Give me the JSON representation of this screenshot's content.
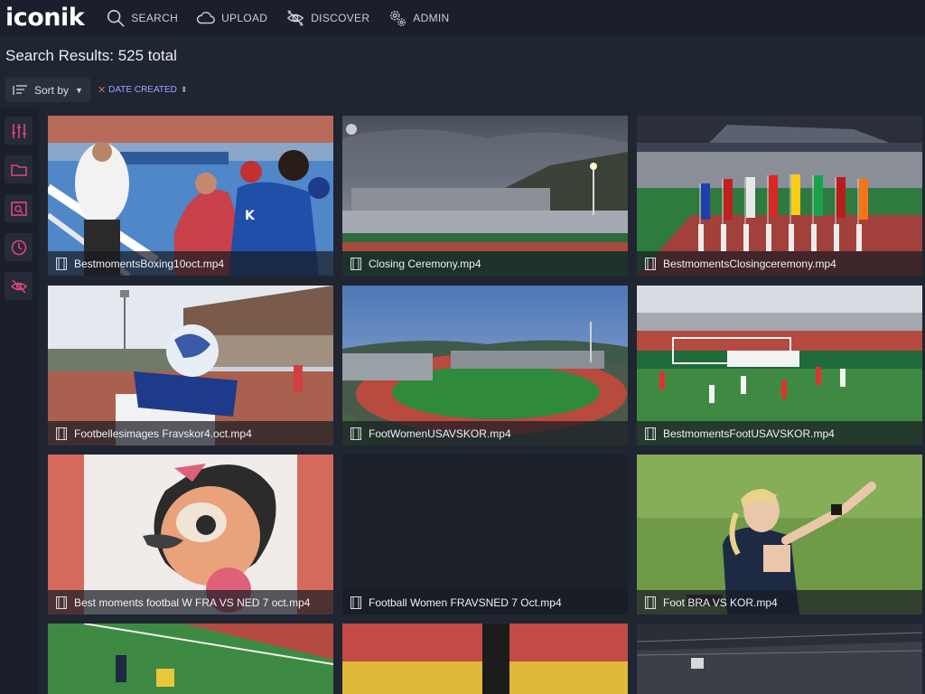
{
  "app": {
    "logo": "iconik"
  },
  "nav": {
    "items": [
      {
        "label": "SEARCH",
        "icon": "search-icon"
      },
      {
        "label": "UPLOAD",
        "icon": "cloud-upload-icon"
      },
      {
        "label": "DISCOVER",
        "icon": "discover-icon"
      },
      {
        "label": "ADMIN",
        "icon": "gear-icon"
      }
    ]
  },
  "results": {
    "title": "Search Results: 525 total",
    "sort_label": "Sort by",
    "sort_field": "DATE CREATED"
  },
  "rail": {
    "items": [
      {
        "icon": "sliders-icon"
      },
      {
        "icon": "folder-icon"
      },
      {
        "icon": "saved-search-icon"
      },
      {
        "icon": "history-icon"
      },
      {
        "icon": "discover-icon"
      }
    ]
  },
  "assets": [
    {
      "filename": "BestmomentsBoxing10oct.mp4"
    },
    {
      "filename": "Closing Ceremony.mp4"
    },
    {
      "filename": "BestmomentsClosingceremony.mp4"
    },
    {
      "filename": "Footbellesimages Fravskor4.oct.mp4"
    },
    {
      "filename": "FootWomenUSAVSKOR.mp4"
    },
    {
      "filename": "BestmomentsFootUSAVSKOR.mp4"
    },
    {
      "filename": "Best moments footbal W FRA VS NED 7 oct.mp4"
    },
    {
      "filename": "Football Women FRAVSNED 7 Oct.mp4"
    },
    {
      "filename": "Foot BRA VS KOR.mp4"
    },
    {
      "filename": ""
    },
    {
      "filename": ""
    },
    {
      "filename": ""
    }
  ],
  "colors": {
    "background": "#202532",
    "topbar": "#1a1f2b",
    "accent": "#9ea6ff",
    "rail_icon": "#e0457a"
  }
}
